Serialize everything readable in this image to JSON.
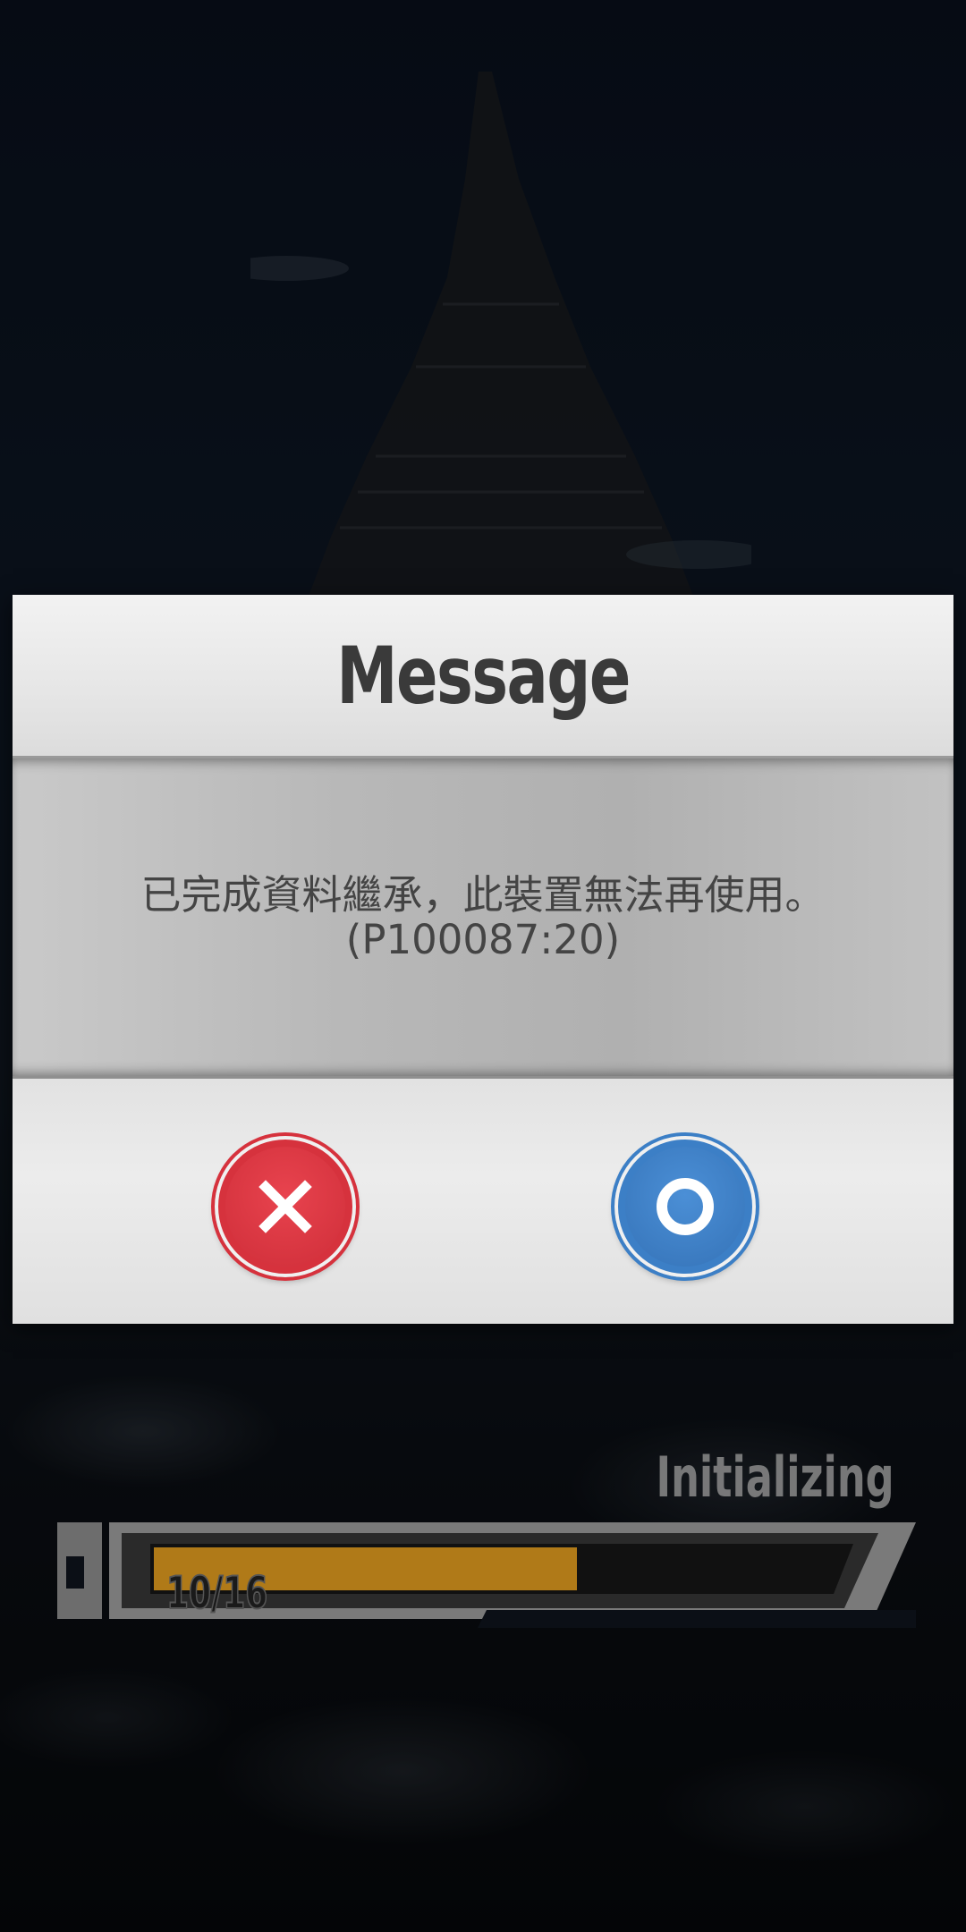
{
  "dialog": {
    "title": "Message",
    "message_line1": "已完成資料繼承，此裝置無法再使用。",
    "message_line2": "(P100087:20)",
    "cancel_icon": "close-icon",
    "confirm_icon": "circle-icon"
  },
  "loading": {
    "status": "Initializing",
    "count_label": "10/16",
    "progress_current": 10,
    "progress_total": 16
  },
  "colors": {
    "cancel": "#d6323d",
    "confirm": "#3c7fc6",
    "progress_fill": "#b07a18"
  }
}
